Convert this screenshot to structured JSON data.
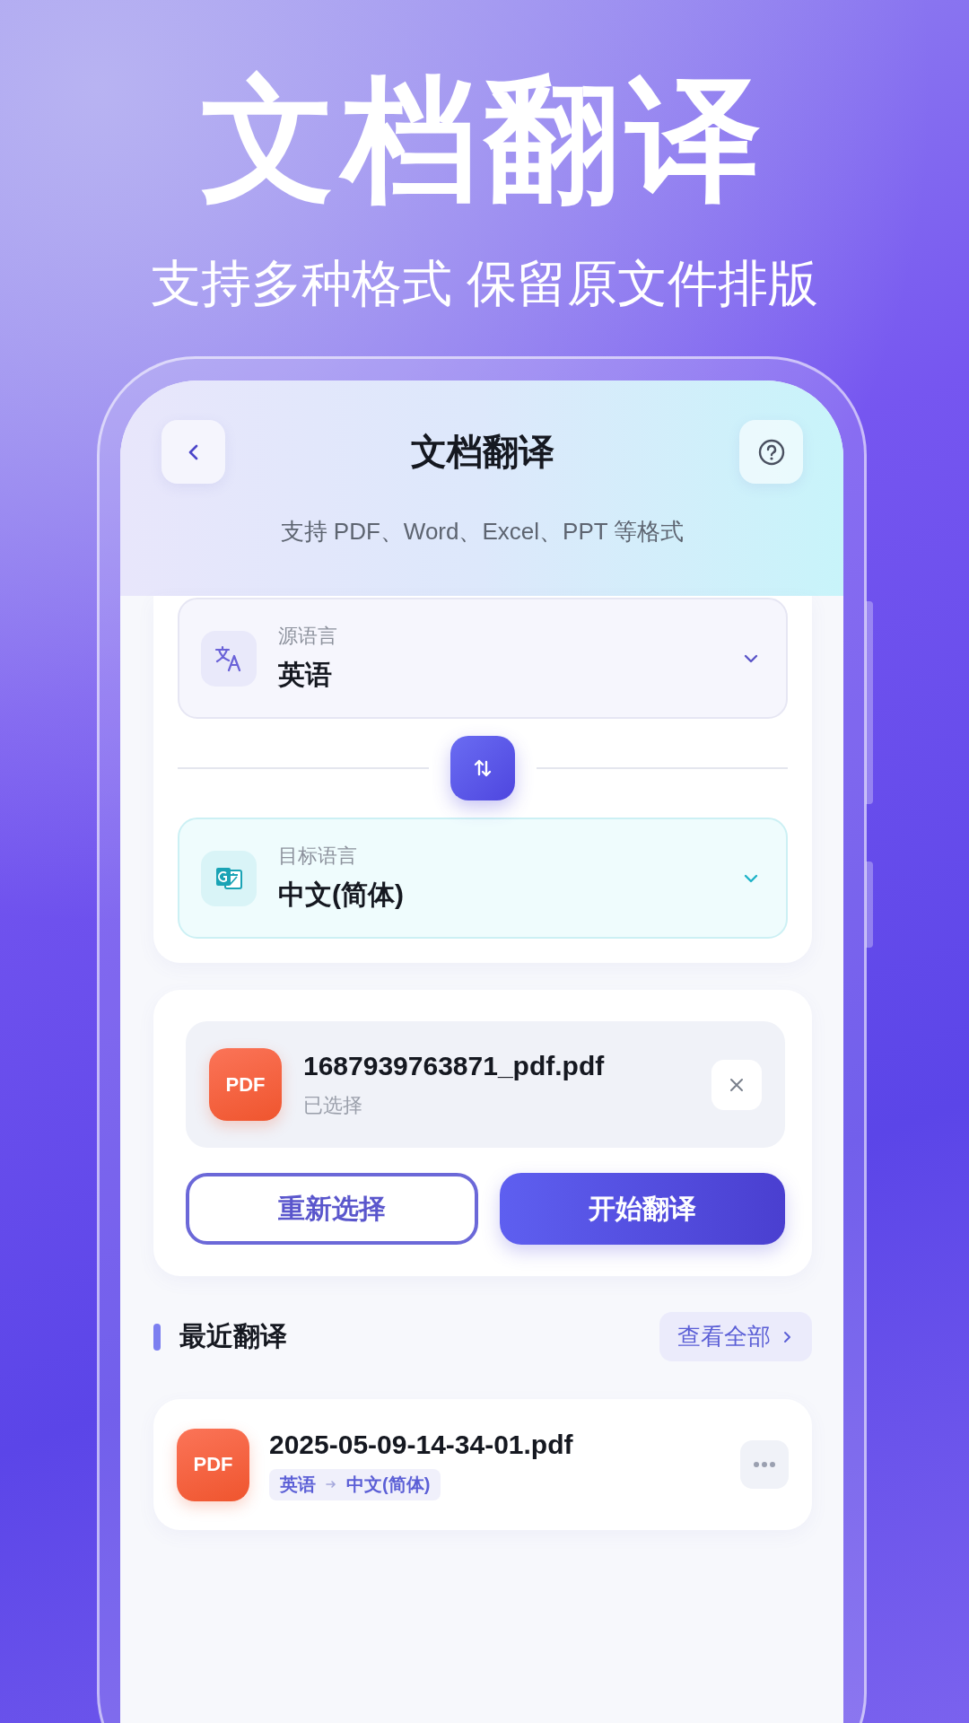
{
  "promo": {
    "title": "文档翻译",
    "subtitle": "支持多种格式 保留原文件排版"
  },
  "header": {
    "title": "文档翻译",
    "subtitle": "支持 PDF、Word、Excel、PPT 等格式"
  },
  "languages": [
    {
      "kind": "source",
      "label": "源语言",
      "value": "英语"
    },
    {
      "kind": "target",
      "label": "目标语言",
      "value": "中文(简体)"
    }
  ],
  "file": {
    "badge": "PDF",
    "name": "1687939763871_pdf.pdf",
    "status": "已选择"
  },
  "buttons": [
    {
      "kind": "outline",
      "label": "重新选择"
    },
    {
      "kind": "primary",
      "label": "开始翻译"
    }
  ],
  "recent": {
    "title": "最近翻译",
    "view_all": "查看全部",
    "items": [
      {
        "badge": "PDF",
        "name": "2025-05-09-14-34-01.pdf",
        "from": "英语",
        "to": "中文(简体)"
      }
    ]
  }
}
